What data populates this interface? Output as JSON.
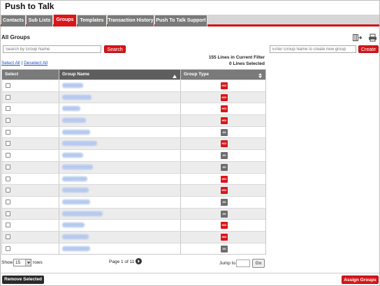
{
  "app": {
    "title": "Push to Talk"
  },
  "tabs": [
    {
      "label": "Contacts"
    },
    {
      "label": "Sub Lists"
    },
    {
      "label": "Groups"
    },
    {
      "label": "Templates"
    },
    {
      "label": "Transaction History"
    },
    {
      "label": "Push To Talk Support"
    }
  ],
  "colors": {
    "accent": "#d9161a",
    "tab_bg": "#7a7a7a",
    "link": "#1a4bc4"
  },
  "section": {
    "title": "All Groups"
  },
  "search": {
    "placeholder": "Search by Group Name",
    "button": "Search"
  },
  "create": {
    "placeholder": "Enter Group Name to create new group",
    "button": "Create"
  },
  "filter": {
    "lines": "155 Lines in Current Filter",
    "selected": "0 Lines Selected"
  },
  "select_links": {
    "select_all": "Select All",
    "separator": "|",
    "deselect_all": "Deselect All"
  },
  "table": {
    "headers": {
      "select": "Select",
      "name": "Group Name",
      "type": "Group Type"
    },
    "rows": [
      {
        "name": "",
        "type": "HD",
        "type_label": "HD!"
      },
      {
        "name": "",
        "type": "HD",
        "type_label": "HD!"
      },
      {
        "name": "",
        "type": "HD",
        "type_label": "HD!"
      },
      {
        "name": "",
        "type": "HD",
        "type_label": "HD!"
      },
      {
        "name": "",
        "type": "3G",
        "type_label": "3G"
      },
      {
        "name": "",
        "type": "HD",
        "type_label": "HD!"
      },
      {
        "name": "",
        "type": "3G",
        "type_label": "3G"
      },
      {
        "name": "",
        "type": "3G",
        "type_label": "3G"
      },
      {
        "name": "",
        "type": "HD",
        "type_label": "HD!"
      },
      {
        "name": "",
        "type": "HD",
        "type_label": "HD!"
      },
      {
        "name": "",
        "type": "3G",
        "type_label": "3G"
      },
      {
        "name": "",
        "type": "3G",
        "type_label": "3G"
      },
      {
        "name": "",
        "type": "HD",
        "type_label": "HD!"
      },
      {
        "name": "",
        "type": "HD",
        "type_label": "HD!"
      },
      {
        "name": "",
        "type": "3G",
        "type_label": "3G"
      }
    ]
  },
  "pager": {
    "show_label": "Show",
    "show_value": "15",
    "rows_label": "rows",
    "page_text": "Page 1 of 11",
    "jump_label": "Jump to",
    "go_label": "Go"
  },
  "actions": {
    "remove": "Remove Selected",
    "assign": "Assign Groups"
  }
}
